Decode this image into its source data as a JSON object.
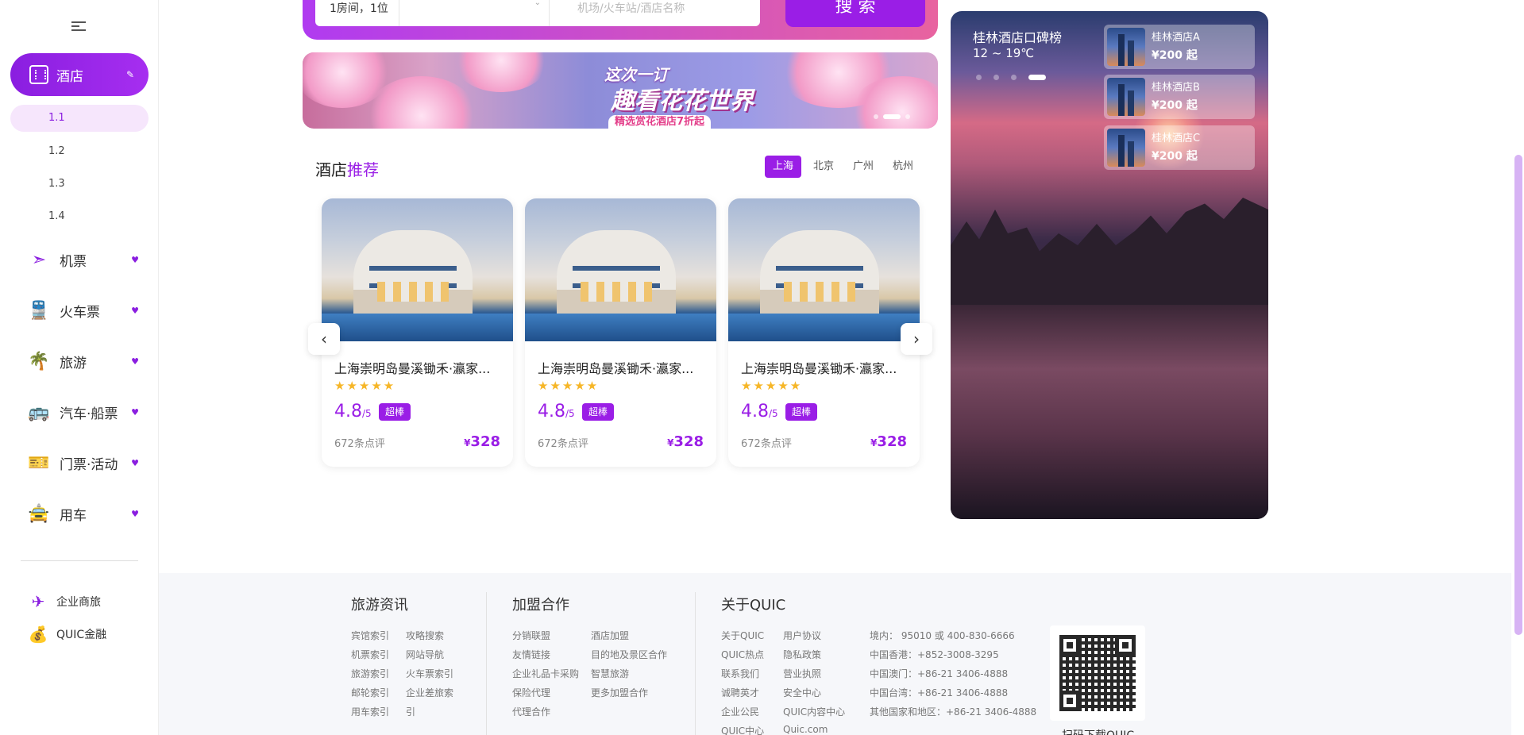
{
  "sidebar": {
    "active": {
      "label": "酒店"
    },
    "subitems": [
      "1.1",
      "1.2",
      "1.3",
      "1.4"
    ],
    "items": [
      {
        "label": "机票",
        "icon": "paper-plane-icon"
      },
      {
        "label": "火车票",
        "icon": "train-icon"
      },
      {
        "label": "旅游",
        "icon": "palm-tree-icon"
      },
      {
        "label": "汽车·船票",
        "icon": "bus-icon"
      },
      {
        "label": "门票·活动",
        "icon": "ticket-icon"
      },
      {
        "label": "用车",
        "icon": "car-icon"
      }
    ],
    "bottom": [
      {
        "label": "企业商旅",
        "icon": "business-travel-icon"
      },
      {
        "label": "QUIC金融",
        "icon": "money-bag-icon"
      }
    ]
  },
  "search": {
    "rooms": "1房间，1位",
    "keyword_placeholder": "机场/火车站/酒店名称",
    "button_label": "搜 索"
  },
  "banner": {
    "subtitle": "这次一订",
    "title": "趣看花花世界",
    "tag": "精选赏花酒店7折起"
  },
  "recommend": {
    "title_a": "酒店",
    "title_b": "推荐",
    "cities": [
      "上海",
      "北京",
      "广州",
      "杭州"
    ],
    "hotels": [
      {
        "name": "上海崇明岛曼溪锄禾·瀛家...",
        "stars": "★★★★★",
        "score": "4.8",
        "score_unit": "/5",
        "badge": "超棒",
        "reviews": "672条点评",
        "currency": "¥",
        "price": "328"
      },
      {
        "name": "上海崇明岛曼溪锄禾·瀛家...",
        "stars": "★★★★★",
        "score": "4.8",
        "score_unit": "/5",
        "badge": "超棒",
        "reviews": "672条点评",
        "currency": "¥",
        "price": "328"
      },
      {
        "name": "上海崇明岛曼溪锄禾·瀛家...",
        "stars": "★★★★★",
        "score": "4.8",
        "score_unit": "/5",
        "badge": "超棒",
        "reviews": "672条点评",
        "currency": "¥",
        "price": "328"
      }
    ]
  },
  "ranking": {
    "title": "桂林酒店口碑榜",
    "temp": "12 ~ 19℃",
    "hotels": [
      {
        "name": "桂林酒店A",
        "price": "¥200 起"
      },
      {
        "name": "桂林酒店B",
        "price": "¥200 起"
      },
      {
        "name": "桂林酒店C",
        "price": "¥200 起"
      }
    ]
  },
  "footer": {
    "col1": {
      "title": "旅游资讯",
      "links": [
        "宾馆索引",
        "攻略搜索",
        "机票索引",
        "网站导航",
        "旅游索引",
        "火车票索引",
        "邮轮索引",
        "企业差旅索",
        "用车索引",
        "引"
      ]
    },
    "col2": {
      "title": "加盟合作",
      "links": [
        "分销联盟",
        "酒店加盟",
        "友情链接",
        "目的地及景区合作",
        "企业礼品卡采购",
        "智慧旅游",
        "保险代理",
        "更多加盟合作",
        "代理合作"
      ]
    },
    "col3": {
      "title": "关于QUIC",
      "links": [
        "关于QUIC",
        "用户协议",
        "QUIC热点",
        "隐私政策",
        "联系我们",
        "营业执照",
        "诚聘英才",
        "安全中心",
        "企业公民",
        "QUIC内容中心",
        "QUIC中心",
        "Quic.com"
      ]
    },
    "contacts": [
      "境内：  95010 或 400-830-6666",
      "中国香港：+852-3008-3295",
      "中国澳门：+86-21 3406-4888",
      "中国台湾：+86-21 3406-4888",
      "其他国家和地区：+86-21 3406-4888"
    ],
    "qr_caption": "扫码下载QUIC"
  },
  "colors": {
    "accent": "#9a1ee6",
    "accent_light": "#f6e6fc"
  }
}
